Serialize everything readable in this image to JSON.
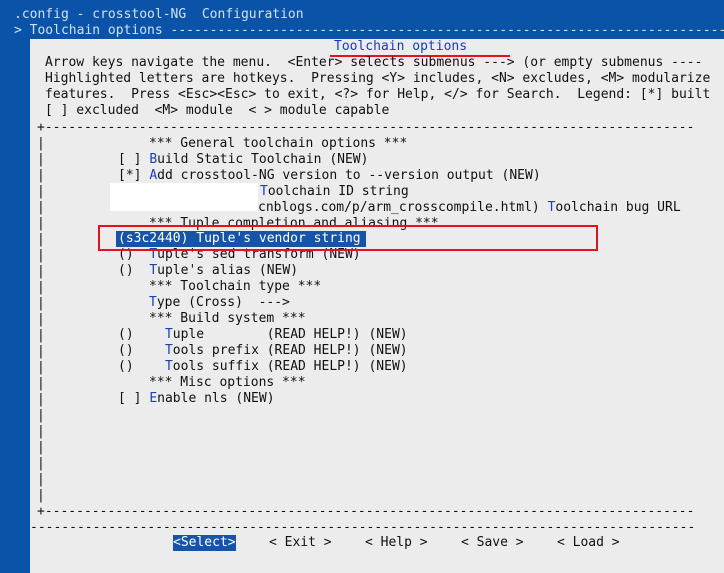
{
  "terminal": {
    "breadcrumb1": ".config - crosstool-NG  Configuration",
    "breadcrumb2": "> Toolchain options -----------------------------------------------------------------------"
  },
  "dialog": {
    "title": "Toolchain options",
    "help_lines": [
      "Arrow keys navigate the menu.  <Enter> selects submenus ---> (or empty submenus ----",
      "Highlighted letters are hotkeys.  Pressing <Y> includes, <N> excludes, <M> modularize",
      "features.  Press <Esc><Esc> to exit, <?> for Help, </> for Search.  Legend: [*] built",
      "[ ] excluded  <M> module  < > module capable"
    ],
    "top_border": "+-----------------------------------------------------------------------------------",
    "bottom_border": "+-----------------------------------------------------------------------------------",
    "button_separator": "-------------------------------------------------------------------------------------",
    "sidebar_char": "|"
  },
  "menu": {
    "items": [
      {
        "prefix": "",
        "hotkey": "",
        "label": "*** General toolchain options ***"
      },
      {
        "prefix": "[ ] ",
        "hotkey": "B",
        "label": "uild Static Toolchain (NEW)"
      },
      {
        "prefix": "[*] ",
        "hotkey": "A",
        "label": "dd crosstool-NG version to --version output (NEW)"
      },
      {
        "prefix": "",
        "hotkey": "T",
        "label": "oolchain ID string"
      },
      {
        "prefix": "",
        "hotkey": "",
        "label": "cnblogs.com/p/arm_crosscompile.html) "
      },
      {
        "prefix": "",
        "hotkey": "",
        "label": "*** Tuple completion and aliasing ***"
      },
      {
        "prefix": "",
        "hotkey": "",
        "label": "(s3c2440) Tuple's vendor string"
      },
      {
        "prefix": "()  ",
        "hotkey": "T",
        "label": "uple's sed transform (NEW)"
      },
      {
        "prefix": "()  ",
        "hotkey": "T",
        "label": "uple's alias (NEW)"
      },
      {
        "prefix": "",
        "hotkey": "",
        "label": "*** Toolchain type ***"
      },
      {
        "prefix": "",
        "hotkey": "T",
        "label": "ype (Cross)  --->"
      },
      {
        "prefix": "",
        "hotkey": "",
        "label": "*** Build system ***"
      },
      {
        "prefix": "()    ",
        "hotkey": "T",
        "label": "uple        (READ HELP!) (NEW)"
      },
      {
        "prefix": "()    ",
        "hotkey": "T",
        "label": "ools prefix (READ HELP!) (NEW)"
      },
      {
        "prefix": "()    ",
        "hotkey": "T",
        "label": "ools suffix (READ HELP!) (NEW)"
      },
      {
        "prefix": "",
        "hotkey": "",
        "label": "*** Misc options ***"
      },
      {
        "prefix": "[ ] ",
        "hotkey": "E",
        "label": "nable nls (NEW)"
      }
    ],
    "bug_url_hotkey": "T",
    "bug_url_rest": "oolchain bug URL"
  },
  "buttons": {
    "select": "<Select>",
    "exit": "< Exit >",
    "help": "< Help >",
    "save": "< Save >",
    "load": "< Load >"
  },
  "colors": {
    "background": "#0a53a8",
    "dialog": "#ececec",
    "selection": "#1554a8",
    "annotation_red": "#e0141a"
  }
}
